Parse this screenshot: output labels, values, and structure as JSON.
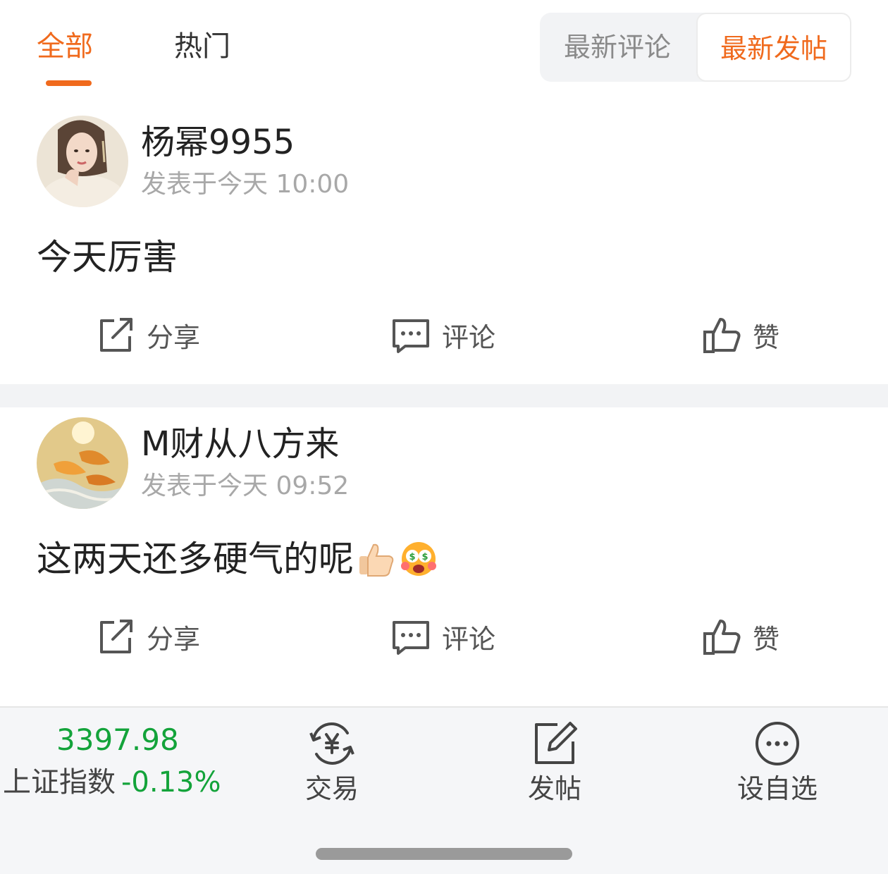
{
  "tabs": {
    "all_label": "全部",
    "hot_label": "热门"
  },
  "sort": {
    "latest_comment_label": "最新评论",
    "latest_post_label": "最新发帖"
  },
  "posts": [
    {
      "username": "杨幂9955",
      "time": "发表于今天 10:00",
      "content": "今天厉害",
      "emojis": [],
      "share_label": "分享",
      "comment_label": "评论",
      "like_label": "赞"
    },
    {
      "username": "M财从八方来",
      "time": "发表于今天 09:52",
      "content": "这两天还多硬气的呢",
      "emojis": [
        "thumbs-up-emoji",
        "money-face-emoji"
      ],
      "share_label": "分享",
      "comment_label": "评论",
      "like_label": "赞"
    }
  ],
  "bottom_bar": {
    "index_value": "3397.98",
    "index_name": "上证指数",
    "index_change": "-0.13%",
    "trade_label": "交易",
    "post_label": "发帖",
    "watchlist_label": "设自选"
  },
  "colors": {
    "accent": "#f06a1d",
    "index_green": "#13a33a",
    "divider": "#f2f3f5"
  }
}
